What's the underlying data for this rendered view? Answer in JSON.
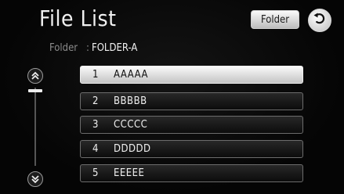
{
  "header": {
    "title": "File List",
    "folder_button_label": "Folder"
  },
  "folder_info": {
    "label": "Folder",
    "separator": ":",
    "value": "FOLDER-A"
  },
  "files": [
    {
      "num": "1",
      "name": "AAAAA",
      "selected": true
    },
    {
      "num": "2",
      "name": "BBBBB",
      "selected": false
    },
    {
      "num": "3",
      "name": "CCCCC",
      "selected": false
    },
    {
      "num": "4",
      "name": "DDDDD",
      "selected": false
    },
    {
      "num": "5",
      "name": "EEEEE",
      "selected": false
    }
  ],
  "icons": {
    "back": "back-arrow-icon",
    "scroll_up": "double-chevron-up-icon",
    "scroll_down": "double-chevron-down-icon"
  },
  "scrollbar": {
    "position": 0.0
  }
}
